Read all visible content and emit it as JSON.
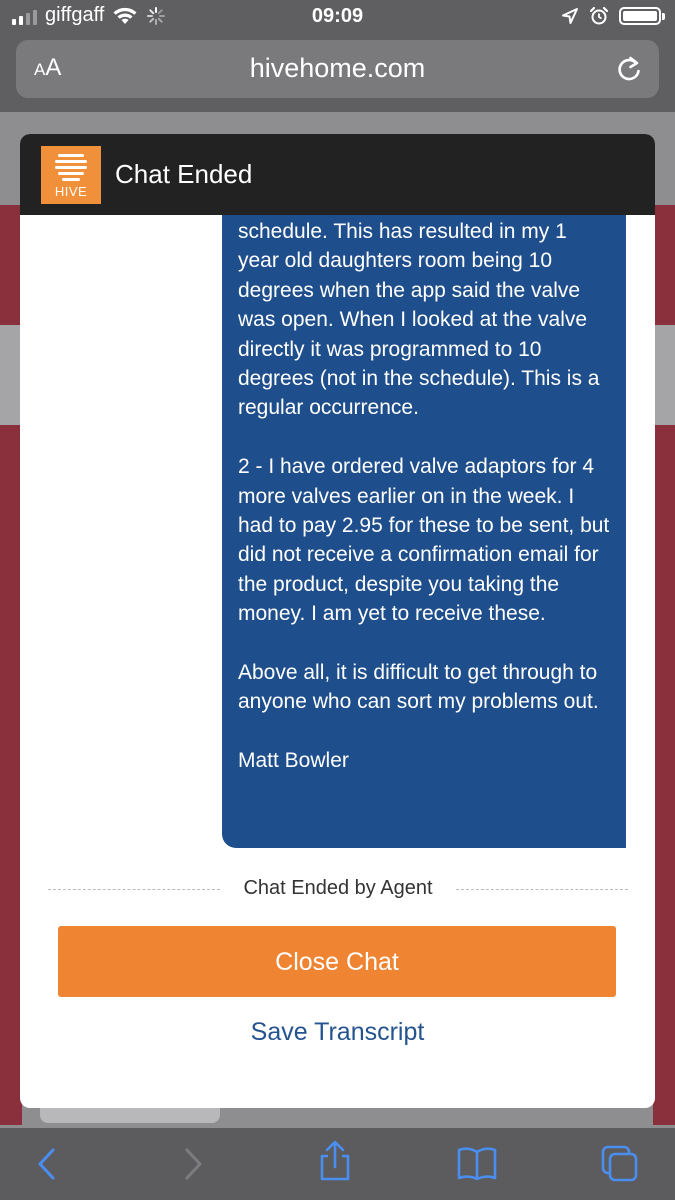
{
  "status_bar": {
    "carrier": "giffgaff",
    "time": "09:09"
  },
  "browser": {
    "text_size_label_small": "A",
    "text_size_label_large": "A",
    "url": "hivehome.com",
    "reload_icon": "reload-icon"
  },
  "chat": {
    "logo_text": "HIVE",
    "title": "Chat Ended",
    "message_paragraphs": [
      "schedule. This has resulted in my 1 year old daughters room being 10 degrees when the app said the valve was open. When I looked at the valve directly it was programmed to 10 degrees (not in the schedule). This is a regular occurrence.",
      "2 - I have ordered valve adaptors for 4 more valves earlier on in the week. I had to pay 2.95 for these to be sent, but did not receive a confirmation email for the product, despite you taking the money. I am yet to receive these.",
      "Above all, it is difficult to get through to anyone who can sort my problems out.",
      "Matt Bowler"
    ],
    "ended_notice": "Chat Ended by Agent",
    "close_button": "Close Chat",
    "save_link": "Save Transcript"
  },
  "colors": {
    "bubble": "#1f4e8c",
    "close_button": "#ef8432",
    "link": "#24538f",
    "header": "#222222",
    "logo": "#f0903a"
  },
  "toolbar": {
    "icons": [
      "back-icon",
      "forward-icon",
      "share-icon",
      "bookmarks-icon",
      "tabs-icon"
    ]
  }
}
